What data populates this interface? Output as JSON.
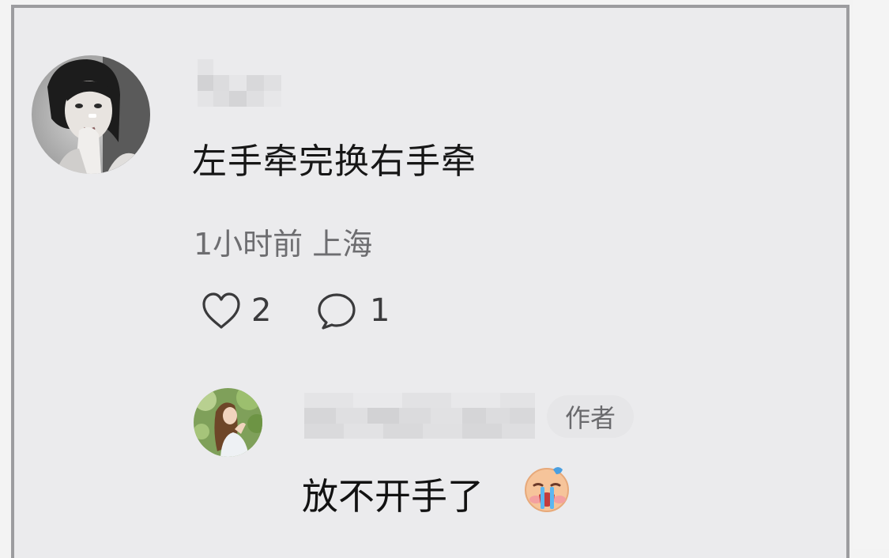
{
  "comment": {
    "author_avatar_icon": "avatar-portrait-grayscale",
    "author_name_icon": "blurred-username",
    "text": "左手牵完换右手牵",
    "meta": "1小时前 上海",
    "likes_count": "2",
    "replies_count": "1",
    "like_icon": "heart-outline-icon",
    "reply_icon": "speech-bubble-icon"
  },
  "reply": {
    "author_avatar_icon": "avatar-woman-greenery",
    "author_name_icon": "blurred-username",
    "badge": "作者",
    "text": "放不开手了",
    "emoji_icon": "crying-face-emoji"
  }
}
